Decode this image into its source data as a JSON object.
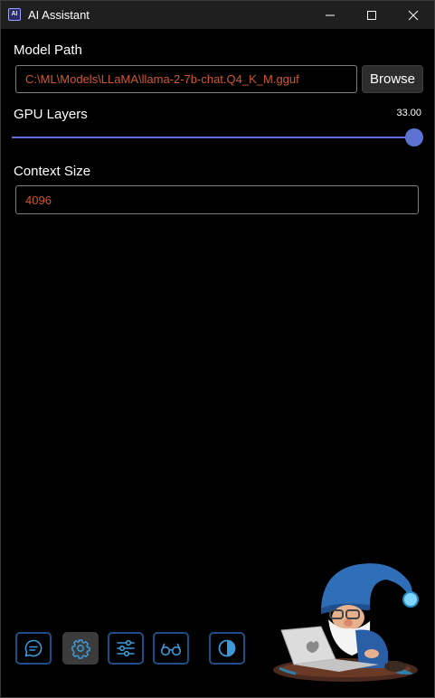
{
  "window": {
    "title": "AI Assistant",
    "icon_label": "AI"
  },
  "model_path": {
    "label": "Model Path",
    "value": "C:\\ML\\Models\\LLaMA\\llama-2-7b-chat.Q4_K_M.gguf",
    "browse_label": "Browse"
  },
  "gpu_layers": {
    "label": "GPU Layers",
    "value_text": "33.00",
    "value": 33,
    "max": 33
  },
  "context_size": {
    "label": "Context Size",
    "value": "4096"
  },
  "nav": {
    "items": [
      {
        "name": "chat",
        "icon": "chat-bubble-icon",
        "active": false
      },
      {
        "name": "settings",
        "icon": "gear-icon",
        "active": true
      },
      {
        "name": "parameters",
        "icon": "sliders-icon",
        "active": false
      },
      {
        "name": "vision",
        "icon": "glasses-icon",
        "active": false
      },
      {
        "name": "theme",
        "icon": "contrast-icon",
        "active": false
      }
    ]
  },
  "colors": {
    "background": "#000000",
    "accent": "#5d73d4",
    "input_text": "#d2572e",
    "nav_border": "#1d4f86",
    "nav_icon": "#3d9ad8"
  }
}
